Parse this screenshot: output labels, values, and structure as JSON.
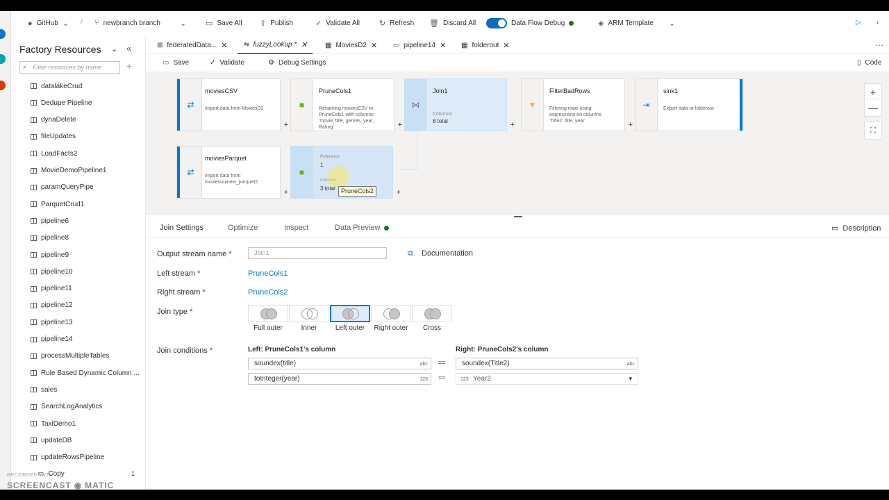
{
  "toolbar": {
    "github": "GitHub",
    "separator": "/",
    "branch": "newbranch branch",
    "save_all": "Save All",
    "publish": "Publish",
    "validate_all": "Validate All",
    "refresh": "Refresh",
    "discard_all": "Discard All",
    "debug": "Data Flow Debug",
    "arm": "ARM Template"
  },
  "sidebar": {
    "title": "Factory Resources",
    "search_placeholder": "Filter resources by name",
    "items": [
      "datalakeCrud",
      "Dedupe Pipeline",
      "dynaDelete",
      "fileUpdates",
      "LoadFacts2",
      "MovieDemoPipeline1",
      "paramQueryPipe",
      "ParquetCrud1",
      "pipeline6",
      "pipeline8",
      "pipeline9",
      "pipeline10",
      "pipeline11",
      "pipeline12",
      "pipeline13",
      "pipeline14",
      "processMultipleTables",
      "Rule Based Dynamic Column ...",
      "sales",
      "SearchLogAnalytics",
      "TaxiDemo1",
      "updateDB",
      "updateRowsPipeline"
    ],
    "copy_label": "Copy",
    "copy_count": "1"
  },
  "tabs": [
    "federatedData...",
    "fuzzyLookup *",
    "MoviesD2",
    "pipeline14",
    "folderout"
  ],
  "subbar": {
    "save": "Save",
    "validate": "Validate",
    "debug_settings": "Debug Settings",
    "code": "Code"
  },
  "nodes": {
    "moviesCSV": {
      "title": "moviesCSV",
      "desc": "Import data from MoviesD2"
    },
    "pruneCols1": {
      "title": "PruneCols1",
      "desc": "Renaming moviesCSV to PruneCols1 with columns 'movie, title, genres, year, Rating'"
    },
    "join1": {
      "title": "Join1",
      "meta": "Columns",
      "value": "8 total"
    },
    "filterBadRows": {
      "title": "FilterBadRows",
      "desc": "Filtering rows using expressions on columns 'Title2, title, year'"
    },
    "sink1": {
      "title": "sink1",
      "desc": "Export data to folderout"
    },
    "moviesParquet": {
      "title": "moviesParquet",
      "desc": "Import data from moviesoutnew_parquet2"
    },
    "ghost": {
      "ref_label": "Reference",
      "ref_value": "1",
      "col_label": "Columns",
      "col_value": "3 total",
      "tooltip": "PruneCols2"
    }
  },
  "panel_tabs": [
    "Join Settings",
    "Optimize",
    "Inspect",
    "Data Preview"
  ],
  "description": "Description",
  "settings": {
    "output_label": "Output stream name",
    "output_value": "Join1",
    "documentation": "Documentation",
    "left_label": "Left stream",
    "left_value": "PruneCols1",
    "right_label": "Right stream",
    "right_value": "PruneCols2",
    "join_type_label": "Join type",
    "join_types": [
      "Full outer",
      "Inner",
      "Left outer",
      "Right outer",
      "Cross"
    ],
    "join_conditions_label": "Join conditions",
    "left_col_header": "Left: PruneCols1's column",
    "right_col_header": "Right: PruneCols2's column",
    "cond1_left": "soundex(title)",
    "cond1_left_tag": "abc",
    "cond1_op": "==",
    "cond1_right": "soundex(Title2)",
    "cond1_right_tag": "abc",
    "cond2_left": "toInteger(year)",
    "cond2_left_tag": "123",
    "cond2_op": "==",
    "cond2_right": "Year2",
    "cond2_right_tag": "123"
  },
  "watermark": {
    "recorded": "RECORDED WITH",
    "brand": "SCREENCAST",
    "brand2": "MATIC"
  }
}
